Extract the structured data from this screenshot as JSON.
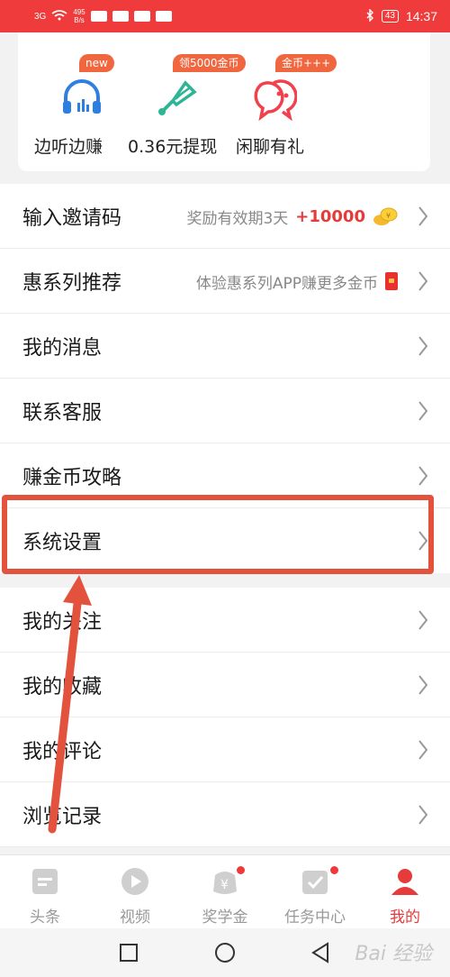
{
  "status_bar": {
    "signal": "3G",
    "net_speed": "495",
    "net_unit": "B/s",
    "battery": "43",
    "time": "14:37"
  },
  "features": [
    {
      "badge": "new",
      "label": "边听边赚",
      "icon": "headphones-icon"
    },
    {
      "badge": "领5000金币",
      "label": "0.36元提现",
      "icon": "badminton-icon"
    },
    {
      "badge": "金币+++",
      "label": "闲聊有礼",
      "icon": "chat-bubbles-icon"
    }
  ],
  "menu_primary": [
    {
      "title": "输入邀请码",
      "desc": "奖励有效期3天",
      "bonus": "+10000"
    },
    {
      "title": "惠系列推荐",
      "desc": "体验惠系列APP赚更多金币"
    },
    {
      "title": "我的消息"
    },
    {
      "title": "联系客服"
    },
    {
      "title": "赚金币攻略"
    },
    {
      "title": "系统设置"
    }
  ],
  "menu_secondary": [
    {
      "title": "我的关注"
    },
    {
      "title": "我的收藏"
    },
    {
      "title": "我的评论"
    },
    {
      "title": "浏览记录"
    }
  ],
  "tabs": [
    {
      "label": "头条",
      "icon": "news-icon",
      "active": false
    },
    {
      "label": "视频",
      "icon": "play-icon",
      "active": false
    },
    {
      "label": "奖学金",
      "icon": "yuan-icon",
      "active": false,
      "dot": true
    },
    {
      "label": "任务中心",
      "icon": "task-check-icon",
      "active": false,
      "dot": true
    },
    {
      "label": "我的",
      "icon": "person-icon",
      "active": true
    }
  ],
  "watermark": "Bai 经验",
  "colors": {
    "accent": "#ef3b3b",
    "badge": "#f0663f",
    "highlight": "#e3523d",
    "icon_blue": "#2f7fe0",
    "icon_green": "#2db596",
    "icon_red": "#f0414c"
  }
}
